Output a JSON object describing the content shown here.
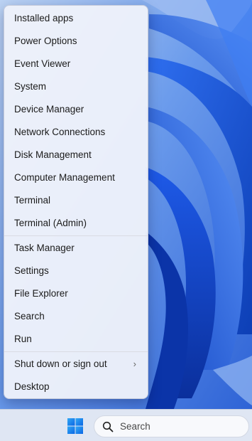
{
  "menu": {
    "items": [
      {
        "label": "Installed apps"
      },
      {
        "label": "Power Options"
      },
      {
        "label": "Event Viewer"
      },
      {
        "label": "System"
      },
      {
        "label": "Device Manager"
      },
      {
        "label": "Network Connections"
      },
      {
        "label": "Disk Management"
      },
      {
        "label": "Computer Management"
      },
      {
        "label": "Terminal"
      },
      {
        "label": "Terminal (Admin)"
      },
      {
        "label": "Task Manager"
      },
      {
        "label": "Settings"
      },
      {
        "label": "File Explorer"
      },
      {
        "label": "Search"
      },
      {
        "label": "Run"
      },
      {
        "label": "Shut down or sign out",
        "chevron": "›"
      },
      {
        "label": "Desktop"
      }
    ]
  },
  "taskbar": {
    "start_icon": "windows-logo-icon",
    "search_icon": "search-icon",
    "search_placeholder": "Search"
  },
  "colors": {
    "accent": "#0a66e4",
    "wallpaper_base": "#5a8ee6"
  }
}
